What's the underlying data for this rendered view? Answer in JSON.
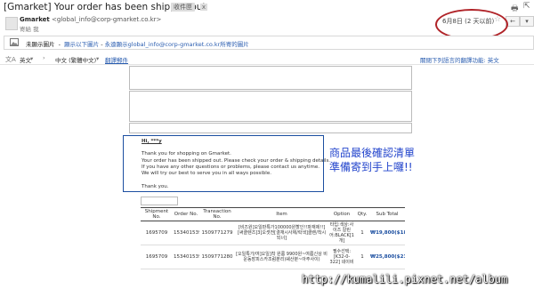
{
  "header": {
    "subject": "[Gmarket] Your order has been shipped out",
    "label_chip": "收件匣",
    "label_x": "x",
    "sender_name": "Gmarket",
    "sender_email": "<global_info@corp-gmarket.co.kr>",
    "to": "寄給 我",
    "date": "6月8日 (2 天以前)",
    "star": "☆",
    "reply": "←",
    "more": "▾",
    "print": "🖶",
    "popout": "⇱"
  },
  "image_bar": {
    "text": "未顯示圖片",
    "link1": "顯示以下圖片",
    "sep": " - ",
    "link2": "永遠顯示global_info@corp-gmarket.co.kr所寄的圖片"
  },
  "translate_bar": {
    "src_lang": "英文",
    "arrow": "›",
    "tgt_lang": "中文 (繁體中文)",
    "translate": "翻譯郵件",
    "right": "關閉下列語言的翻譯功能: 英文"
  },
  "email": {
    "greeting": "Hi, ***y",
    "line1": "Thank you for shopping on Gmarket.",
    "line2": "Your order has been shipped out. Please check your order & shipping details.",
    "line3": "If you have any other questions or problems, please contact us anytime.",
    "line4": "We will try our best to serve you in all ways possible.",
    "line5": "Thank you."
  },
  "annotation": {
    "line1": "商品最後確認清單",
    "line2": "準備寄到手上囉!!"
  },
  "orders": {
    "headers": [
      "Shipment No.",
      "Order No.",
      "Transaction No.",
      "Item",
      "Option",
      "Qty.",
      "Sub Total"
    ],
    "rows": [
      [
        "1695709",
        "1534015396",
        "1509771279",
        "[비즈원]오일판특가100000원할인!!파재제!!][써클렌즈]3]오셋전[결재시사제/락색]클렌/착시되너]",
        "타입:색상:사이즈 칼린어:BLACK[1개]",
        "1",
        "₩19,800($18.01)"
      ],
      [
        "1695709",
        "1534015396",
        "1509771280",
        "[오일특가/여]오일]착 원룸 9900원~여름신상 비운동장피스카조럼분리)쉐산분~아주사이)",
        "필수선택:[K32-0-322] 네이비",
        "1",
        "₩25,800($23.50)"
      ]
    ]
  },
  "watermark": "http://kumalili.pixnet.net/album",
  "colors": {
    "annotation": "#2244cc",
    "card_border": "#1c4fa0",
    "oval": "#b02328",
    "link": "#2a5db0"
  }
}
